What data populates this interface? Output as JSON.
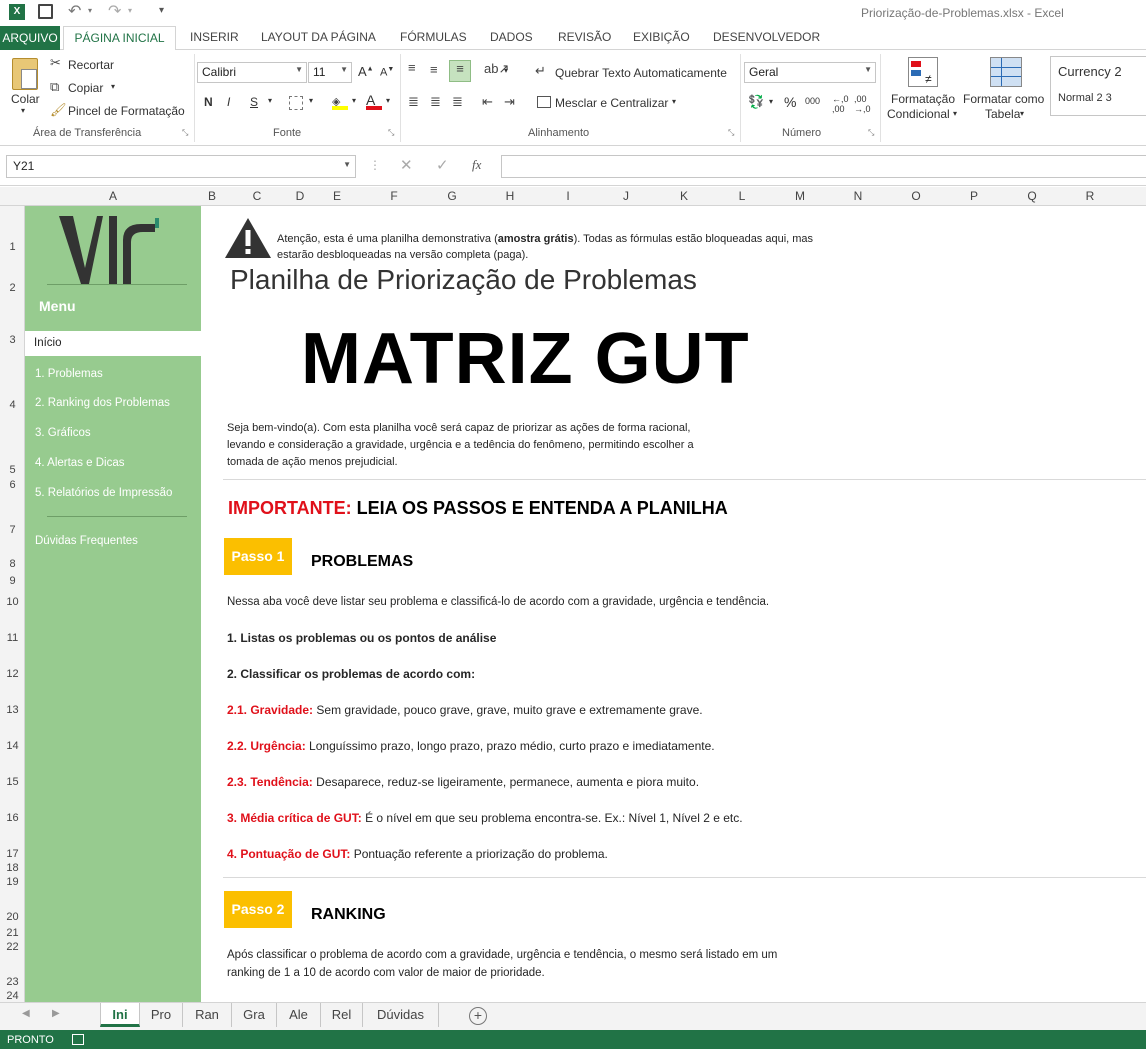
{
  "window": {
    "title": "Priorização-de-Problemas.xlsx - Excel"
  },
  "ribbon_tabs": [
    "ARQUIVO",
    "PÁGINA INICIAL",
    "INSERIR",
    "LAYOUT DA PÁGINA",
    "FÓRMULAS",
    "DADOS",
    "REVISÃO",
    "EXIBIÇÃO",
    "DESENVOLVEDOR"
  ],
  "clipboard": {
    "paste": "Colar",
    "cut": "Recortar",
    "copy": "Copiar",
    "format_painter": "Pincel de Formatação",
    "group": "Área de Transferência"
  },
  "font": {
    "name": "Calibri",
    "size": "11",
    "group": "Fonte",
    "bold": "N",
    "italic": "I",
    "underline": "S"
  },
  "alignment": {
    "wrap": "Quebrar Texto Automaticamente",
    "merge": "Mesclar e Centralizar",
    "group": "Alinhamento"
  },
  "number": {
    "format": "Geral",
    "percent": "%",
    "thousands": "000",
    "group": "Número"
  },
  "styles": {
    "cond_format_1": "Formatação",
    "cond_format_2": "Condicional",
    "table_format_1": "Formatar como",
    "table_format_2": "Tabela",
    "style_1": "Currency 2",
    "style_2": "Normal 2 3"
  },
  "formula_bar": {
    "name_box": "Y21",
    "fx": "fx"
  },
  "columns": [
    "A",
    "B",
    "C",
    "D",
    "E",
    "F",
    "G",
    "H",
    "I",
    "J",
    "K",
    "L",
    "M",
    "N",
    "O",
    "P",
    "Q",
    "R"
  ],
  "rows": [
    "1",
    "2",
    "3",
    "4",
    "5",
    "6",
    "7",
    "8",
    "9",
    "10",
    "11",
    "12",
    "13",
    "14",
    "15",
    "16",
    "17",
    "18",
    "19",
    "20",
    "21",
    "22",
    "23",
    "24"
  ],
  "sidebar": {
    "logo": "VLr",
    "menu_title": "Menu",
    "active": "Início",
    "items": [
      "1. Problemas",
      "2. Ranking dos Problemas",
      "3. Gráficos",
      "4. Alertas e Dicas",
      "5. Relatórios de Impressão"
    ],
    "faq": "Dúvidas Frequentes"
  },
  "content": {
    "warning_pre": "Atenção, esta é uma planilha demonstrativa (",
    "warning_bold": "amostra grátis",
    "warning_post": "). Todas as fórmulas estão bloqueadas aqui, mas",
    "warning_line2": "estarão desbloqueadas na versão completa (paga).",
    "subtitle": "Planilha de Priorização de Problemas",
    "title": "MATRIZ GUT",
    "welcome_1": "Seja bem-vindo(a). Com esta planilha você será capaz de priorizar as ações de forma racional,",
    "welcome_2": "levando e consideração a gravidade, urgência e a tedência do fenômeno, permitindo escolher a",
    "welcome_3": "tomada de ação menos prejudicial.",
    "important_label": "IMPORTANTE:",
    "important_text": "LEIA OS PASSOS E ENTENDA A PLANILHA",
    "step1_badge": "Passo 1",
    "step1_title": "PROBLEMAS",
    "step1_desc": "Nessa aba você deve listar seu problema e classificá-lo de acordo com a gravidade, urgência e tendência.",
    "item1": "1. Listas os problemas ou os pontos de análise",
    "item2": "2. Classificar os problemas de acordo com:",
    "item21_label": "2.1. Gravidade:",
    "item21_text": "Sem gravidade, pouco grave, grave, muito grave e extremamente grave.",
    "item22_label": "2.2. Urgência:",
    "item22_text": "Longuíssimo prazo, longo prazo, prazo médio, curto prazo e imediatamente.",
    "item23_label": "2.3. Tendência:",
    "item23_text": "Desaparece, reduz-se ligeiramente, permanece, aumenta e piora muito.",
    "item3_label": "3. Média crítica de GUT:",
    "item3_text": "É o nível em que seu problema encontra-se. Ex.: Nível 1, Nível 2 e etc.",
    "item4_label": "4. Pontuação de GUT:",
    "item4_text": "Pontuação referente a priorização do problema.",
    "step2_badge": "Passo 2",
    "step2_title": "RANKING",
    "step2_desc_1": "Após classificar o problema de acordo com a gravidade, urgência e tendência, o mesmo será listado  em um",
    "step2_desc_2": "ranking de 1 a 10 de acordo com valor de maior de prioridade."
  },
  "sheet_tabs": [
    "Ini",
    "Pro",
    "Ran",
    "Gra",
    "Ale",
    "Rel",
    "Dúvidas"
  ],
  "status": {
    "text": "PRONTO"
  },
  "colors": {
    "excel_green": "#217346",
    "sidebar_green": "#97cb8f",
    "step_yellow": "#fbbf00",
    "important_red": "#e0101a"
  }
}
